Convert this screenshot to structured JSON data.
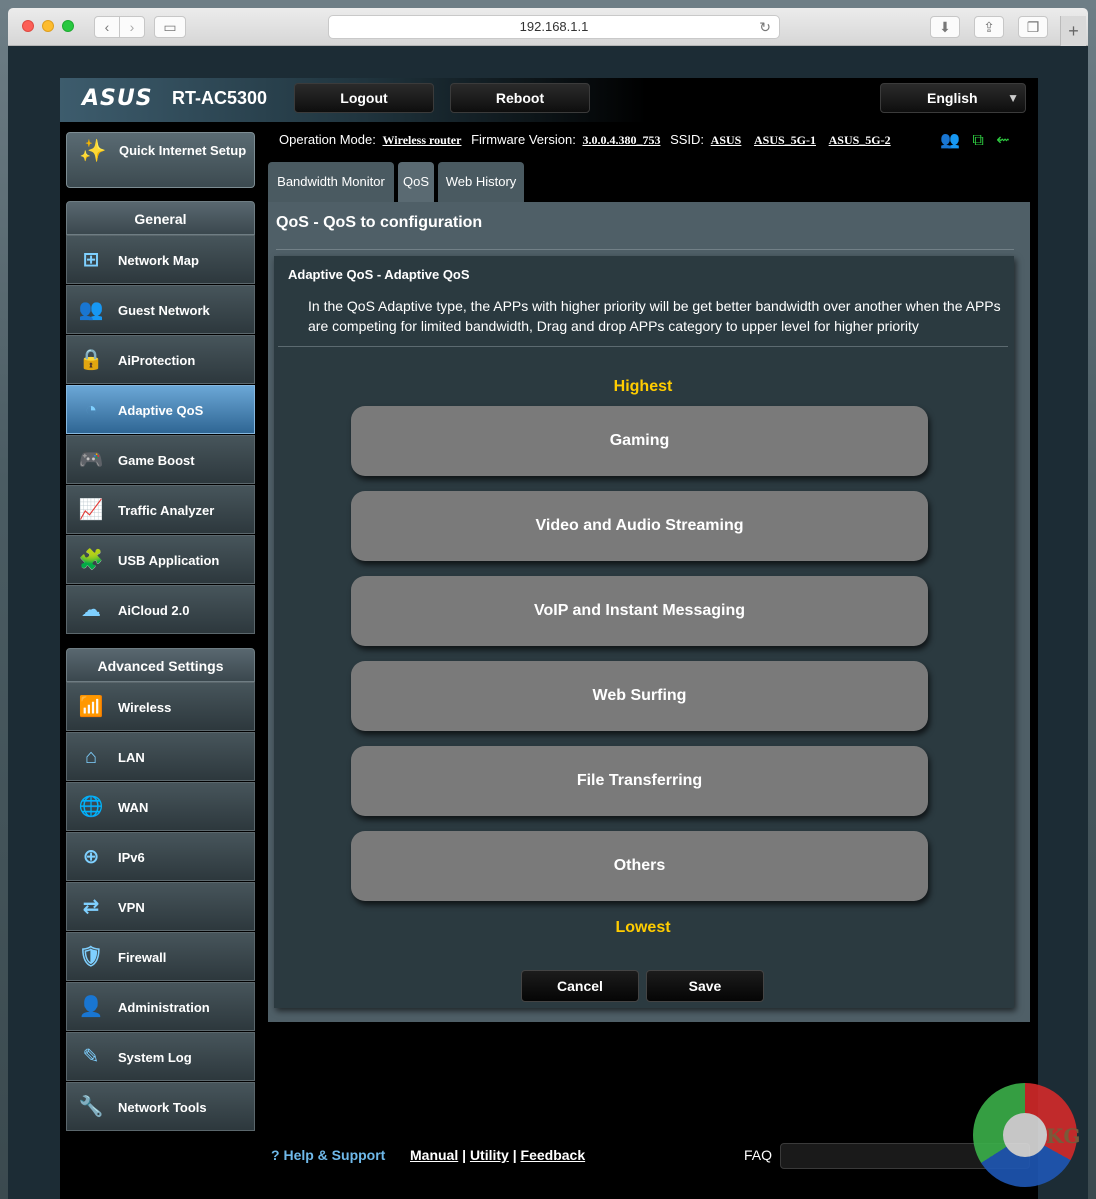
{
  "browser": {
    "url": "192.168.1.1",
    "reload_icon": "reload-icon",
    "new_tab_label": "+"
  },
  "header": {
    "brand": "ASUS",
    "model": "RT-AC5300",
    "logout_label": "Logout",
    "reboot_label": "Reboot",
    "language": "English"
  },
  "sidebar": {
    "quick_setup_label": "Quick Internet Setup",
    "general_heading": "General",
    "general_items": [
      {
        "label": "Network Map",
        "icon": "network-map-icon"
      },
      {
        "label": "Guest Network",
        "icon": "guest-network-icon"
      },
      {
        "label": "AiProtection",
        "icon": "lock-icon"
      },
      {
        "label": "Adaptive QoS",
        "icon": "speedometer-icon",
        "active": true
      },
      {
        "label": "Game Boost",
        "icon": "gamepad-icon"
      },
      {
        "label": "Traffic Analyzer",
        "icon": "chart-icon"
      },
      {
        "label": "USB Application",
        "icon": "puzzle-icon"
      },
      {
        "label": "AiCloud 2.0",
        "icon": "cloud-icon"
      }
    ],
    "advanced_heading": "Advanced Settings",
    "advanced_items": [
      {
        "label": "Wireless",
        "icon": "wifi-icon"
      },
      {
        "label": "LAN",
        "icon": "home-icon"
      },
      {
        "label": "WAN",
        "icon": "globe-icon"
      },
      {
        "label": "IPv6",
        "icon": "ipv6-icon"
      },
      {
        "label": "VPN",
        "icon": "vpn-icon"
      },
      {
        "label": "Firewall",
        "icon": "shield-icon"
      },
      {
        "label": "Administration",
        "icon": "user-icon"
      },
      {
        "label": "System Log",
        "icon": "log-icon"
      },
      {
        "label": "Network Tools",
        "icon": "tools-icon"
      }
    ]
  },
  "status": {
    "operation_mode_label": "Operation Mode:",
    "operation_mode_value": "Wireless router",
    "firmware_label": "Firmware Version:",
    "firmware_value": "3.0.0.4.380_753",
    "ssid_label": "SSID:",
    "ssid_values": [
      "ASUS",
      "ASUS_5G-1",
      "ASUS_5G-2"
    ]
  },
  "tabs": [
    "Bandwidth Monitor",
    "QoS",
    "Web History"
  ],
  "main": {
    "title": "QoS - QoS to configuration",
    "section_title": "Adaptive QoS - Adaptive QoS",
    "description": "In the QoS Adaptive type, the APPs with higher priority will be get better bandwidth over another when the APPs are competing for limited bandwidth, Drag and drop APPs category to upper level for higher priority",
    "highest_label": "Highest",
    "lowest_label": "Lowest",
    "categories": [
      "Gaming",
      "Video and Audio Streaming",
      "VoIP and Instant Messaging",
      "Web Surfing",
      "File Transferring",
      "Others"
    ],
    "cancel_label": "Cancel",
    "save_label": "Save"
  },
  "footer": {
    "help_label": "Help & Support",
    "manual_label": "Manual",
    "utility_label": "Utility",
    "feedback_label": "Feedback",
    "separator": "|",
    "faq_label": "FAQ"
  },
  "watermark": {
    "text": "KG"
  },
  "colors": {
    "priority_label": "#ffcc00",
    "active_menu": "#2f6694",
    "help_link": "#6fb9ea"
  }
}
